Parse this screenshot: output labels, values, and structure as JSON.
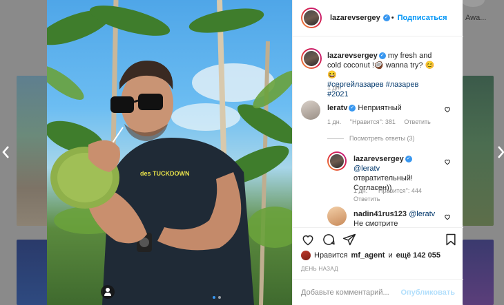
{
  "background": {
    "story_label": "Awa..."
  },
  "carousel": {
    "prev_icon": "chevron-left-icon",
    "next_icon": "chevron-right-icon",
    "image_index": 1,
    "image_count": 2
  },
  "post": {
    "author": "lazarevsergey",
    "follow_label": "Подписаться",
    "caption_text": "my fresh and cold coconut !🥥 wanna try? 😊😆",
    "caption_tags": "#сергейлазарев #лазарев #2021",
    "caption_age": "1 дн."
  },
  "comments": [
    {
      "user": "leratv",
      "verified": true,
      "text": "Неприятный",
      "age": "1 дн.",
      "likes": "\"Нравится\": 381",
      "reply_label": "Ответить"
    }
  ],
  "view_replies_label": "Посмотреть ответы (3)",
  "replies": [
    {
      "user": "lazarevsergey",
      "verified": true,
      "mention": "@leratv",
      "text": "отвратительный! Согласен))",
      "age": "1 дн.",
      "likes": "\"Нравится\": 444",
      "reply_label": "Ответить"
    },
    {
      "user": "nadin41rus123",
      "verified": false,
      "mention": "@leratv",
      "text": "Не смотрите"
    }
  ],
  "likes": {
    "prefix": "Нравится",
    "user": "mf_agent",
    "middle": "и",
    "count": "ещё 142 055"
  },
  "date_label": "ДЕНЬ НАЗАД",
  "comment_box": {
    "placeholder": "Добавьте комментарий...",
    "publish_label": "Опубликовать"
  }
}
